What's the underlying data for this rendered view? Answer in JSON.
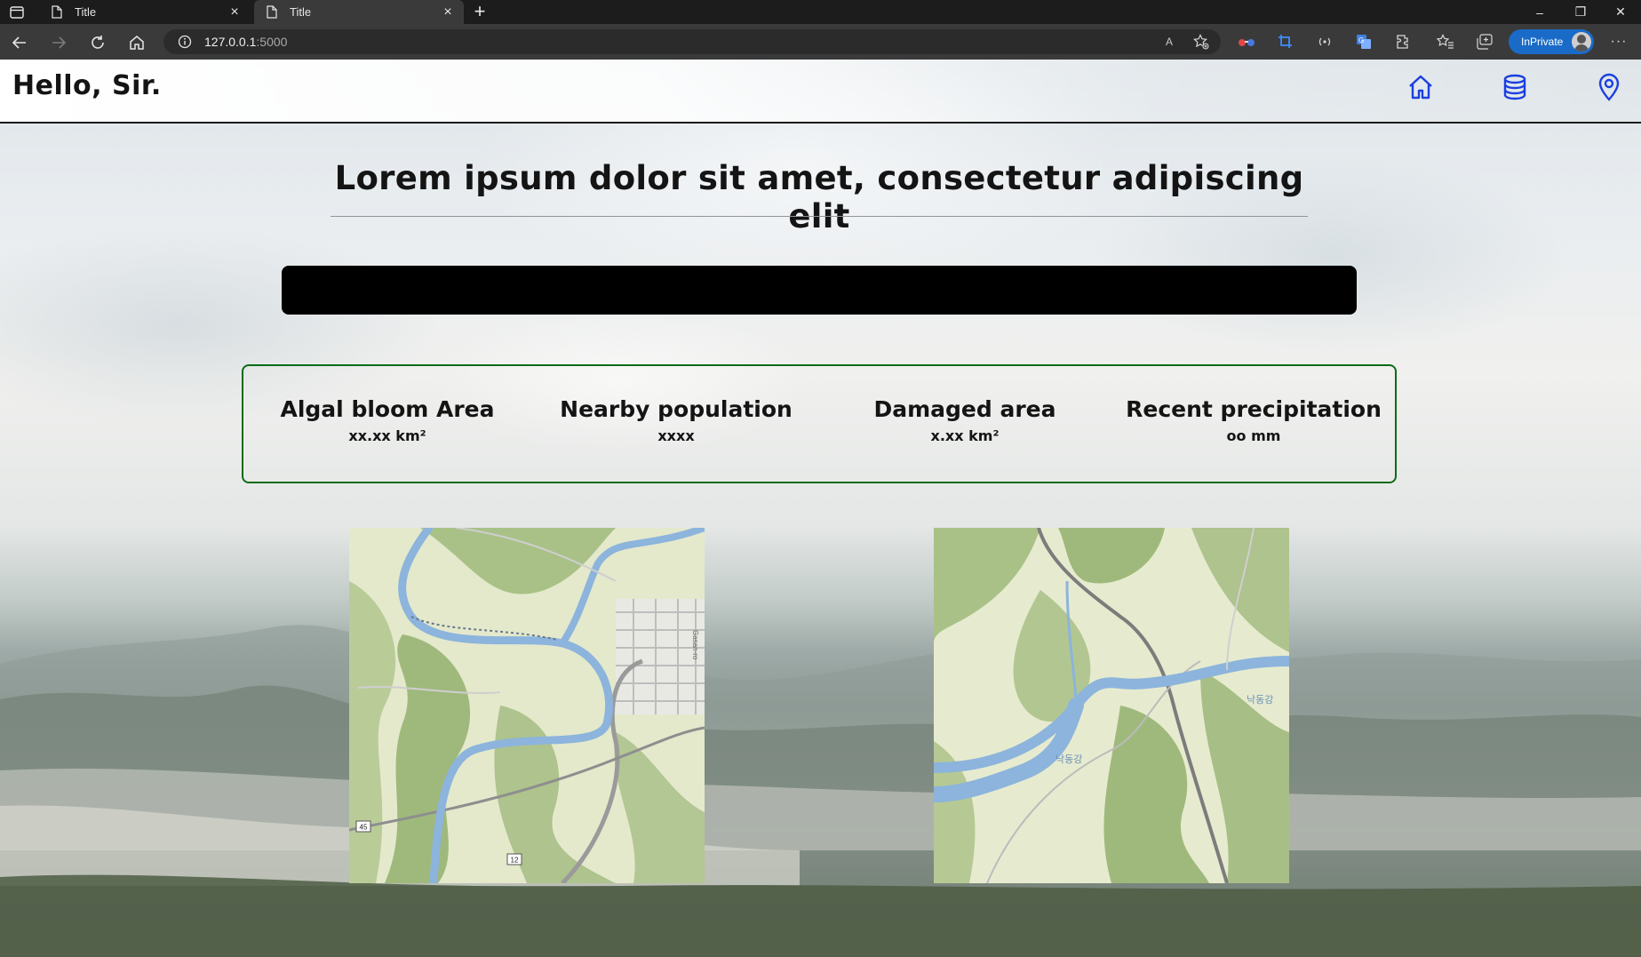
{
  "browser": {
    "tabs": [
      {
        "title": "Title",
        "active": false
      },
      {
        "title": "Title",
        "active": true
      }
    ],
    "address": {
      "host": "127.0.0.1",
      "port": ":5000"
    },
    "read_aloud_label": "A",
    "inprivate_label": "InPrivate",
    "more_label": "···",
    "window": {
      "minimize": "–",
      "restore": "❐",
      "close": "✕"
    }
  },
  "page": {
    "brand": "Hello, Sir.",
    "nav": [
      "home-icon",
      "database-icon",
      "location-pin-icon"
    ],
    "headline": "Lorem ipsum dolor sit amet, consectetur adipiscing elit",
    "stats": [
      {
        "label": "Algal bloom Area",
        "value": "xx.xx km²"
      },
      {
        "label": "Nearby population",
        "value": "xxxx"
      },
      {
        "label": "Damaged area",
        "value": "x.xx km²"
      },
      {
        "label": "Recent precipitation",
        "value": "oo mm"
      }
    ],
    "maps": {
      "left": {
        "road_labels": [
          "45",
          "12"
        ],
        "street_label": "Gasan-ro"
      },
      "right": {
        "river_labels": [
          "낙동강",
          "낙동강"
        ]
      }
    }
  },
  "colors": {
    "accent_nav": "#1b3fe0",
    "stats_border": "#0b6b17",
    "inprivate": "#1a6bc7"
  }
}
